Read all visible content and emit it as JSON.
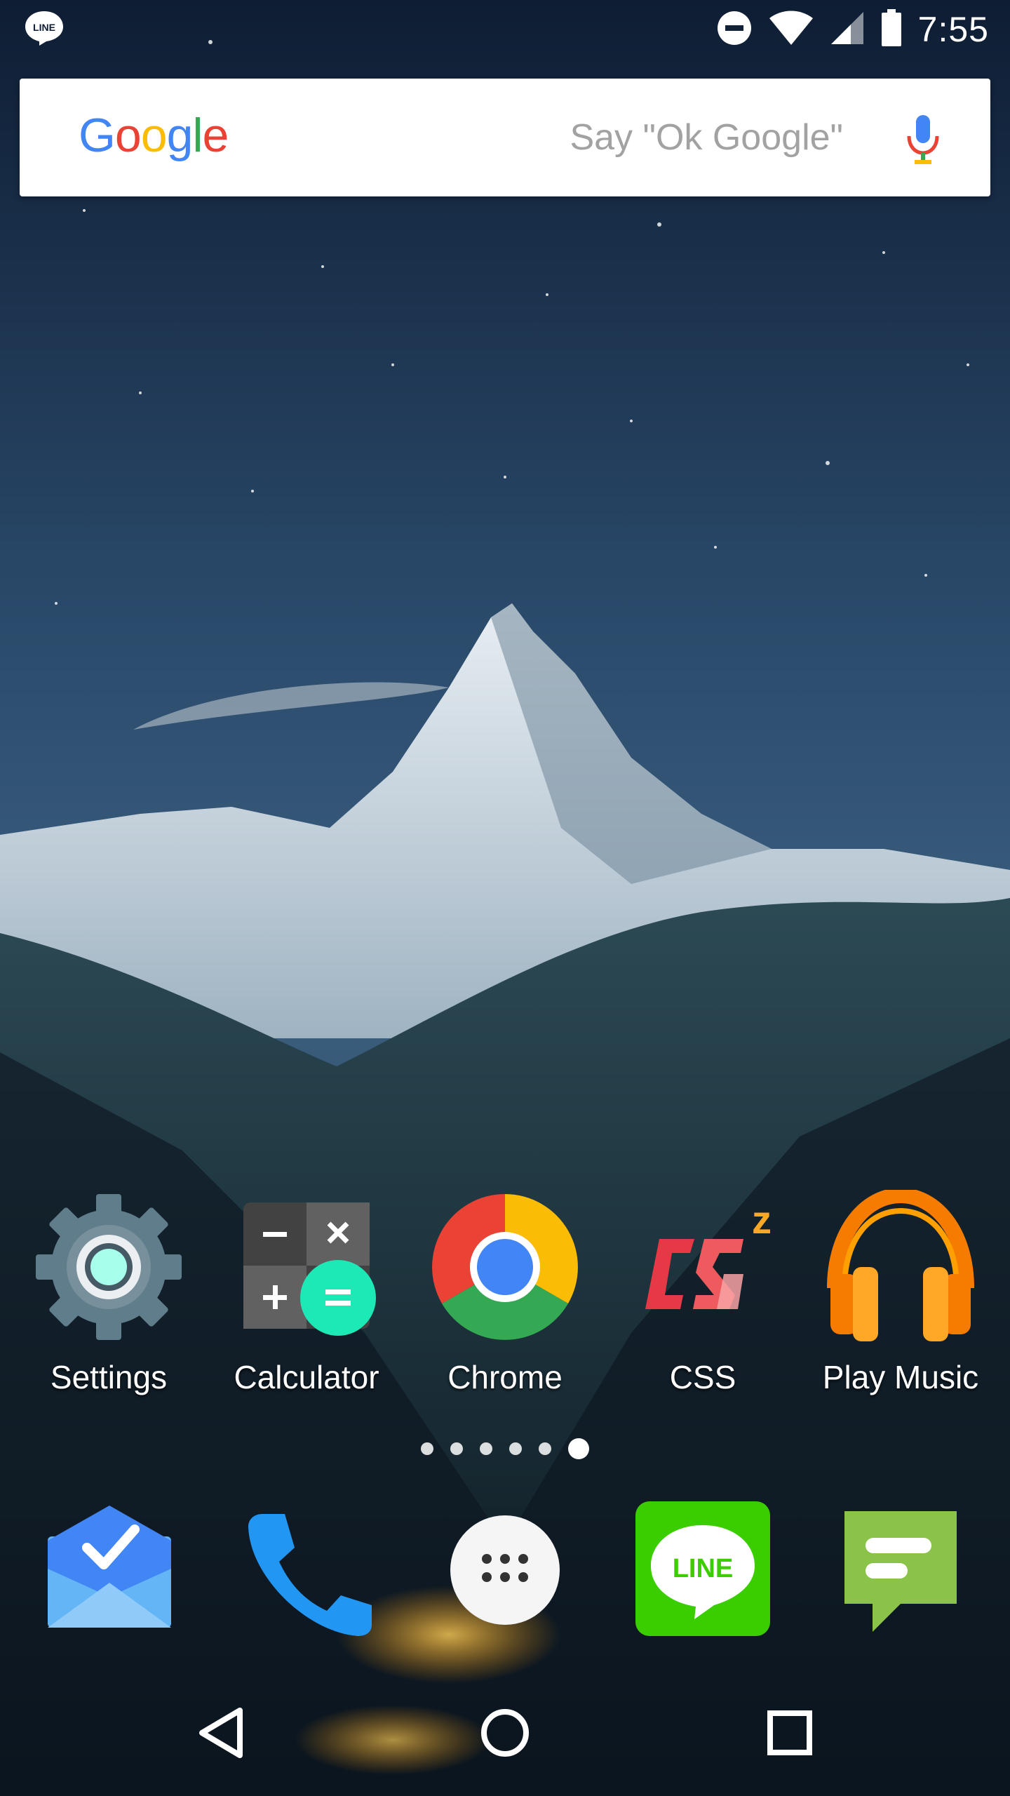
{
  "status_bar": {
    "notification_icon": "line-notification-icon",
    "icons": [
      "do-not-disturb-icon",
      "wifi-icon",
      "cell-signal-icon",
      "battery-icon"
    ],
    "time": "7:55"
  },
  "search": {
    "logo": "Google",
    "hint": "Say \"Ok Google\"",
    "mic_icon": "mic-icon"
  },
  "apps": [
    {
      "label": "Settings",
      "icon": "settings-icon"
    },
    {
      "label": "Calculator",
      "icon": "calculator-icon"
    },
    {
      "label": "Chrome",
      "icon": "chrome-icon"
    },
    {
      "label": "CSS",
      "icon": "css-icon"
    },
    {
      "label": "Play Music",
      "icon": "play-music-icon"
    }
  ],
  "pager": {
    "count": 6,
    "active_index": 5
  },
  "dock": [
    {
      "icon": "inbox-icon"
    },
    {
      "icon": "phone-icon"
    },
    {
      "icon": "app-drawer-icon"
    },
    {
      "icon": "line-app-icon",
      "text": "LINE"
    },
    {
      "icon": "messenger-icon"
    }
  ],
  "nav": [
    "back-icon",
    "home-icon",
    "recents-icon"
  ],
  "colors": {
    "google_blue": "#4285F4",
    "google_red": "#EA4335",
    "google_yellow": "#FBBC05",
    "google_green": "#34A853",
    "line_green": "#3ACE01"
  }
}
